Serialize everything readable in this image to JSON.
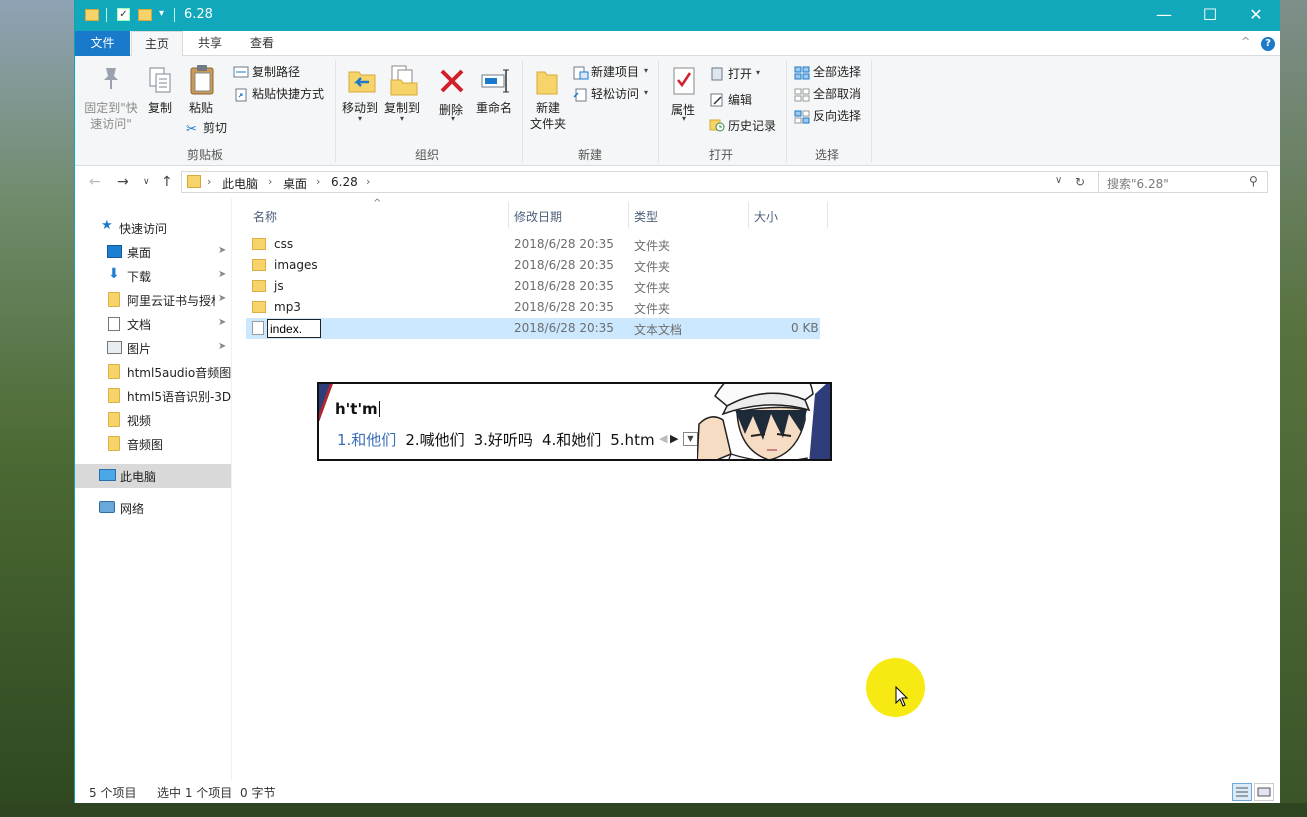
{
  "window": {
    "title": "6.28",
    "quick_access_toolbar": [
      "folder-icon",
      "properties-check-icon",
      "new-folder-icon",
      "customize-arrow"
    ]
  },
  "menu": {
    "file": "文件",
    "tabs": [
      {
        "label": "主页",
        "active": true
      },
      {
        "label": "共享",
        "active": false
      },
      {
        "label": "查看",
        "active": false
      }
    ],
    "help": "?"
  },
  "ribbon": {
    "clipboard": {
      "label": "剪贴板",
      "pin": "固定到\"快速访问\"",
      "copy": "复制",
      "paste": "粘贴",
      "copy_path": "复制路径",
      "paste_shortcut": "粘贴快捷方式",
      "cut": "剪切"
    },
    "organize": {
      "label": "组织",
      "move_to": "移动到",
      "copy_to": "复制到",
      "delete": "删除",
      "rename": "重命名"
    },
    "new": {
      "label": "新建",
      "new_folder": "新建\n文件夹",
      "new_item": "新建项目",
      "easy_access": "轻松访问"
    },
    "open": {
      "label": "打开",
      "properties": "属性",
      "open": "打开",
      "edit": "编辑",
      "history": "历史记录"
    },
    "select": {
      "label": "选择",
      "select_all": "全部选择",
      "select_none": "全部取消",
      "invert": "反向选择"
    }
  },
  "address": {
    "crumbs": [
      "此电脑",
      "桌面",
      "6.28"
    ],
    "search_placeholder": "搜索\"6.28\""
  },
  "nav": {
    "quick_access": "快速访问",
    "items": [
      {
        "label": "桌面",
        "icon": "desktop-icon",
        "pinned": true
      },
      {
        "label": "下载",
        "icon": "download-icon",
        "pinned": true
      },
      {
        "label": "阿里云证书与授权",
        "icon": "folder-icon",
        "pinned": true
      },
      {
        "label": "文档",
        "icon": "document-icon",
        "pinned": true
      },
      {
        "label": "图片",
        "icon": "picture-icon",
        "pinned": true
      },
      {
        "label": "html5audio音频图形",
        "icon": "folder-icon",
        "pinned": false
      },
      {
        "label": "html5语音识别-3D效果",
        "icon": "folder-icon",
        "pinned": false
      },
      {
        "label": "视频",
        "icon": "folder-icon",
        "pinned": false
      },
      {
        "label": "音频图",
        "icon": "folder-icon",
        "pinned": false
      }
    ],
    "this_pc": "此电脑",
    "network": "网络"
  },
  "files": {
    "columns": {
      "name": "名称",
      "modified": "修改日期",
      "type": "类型",
      "size": "大小"
    },
    "rows": [
      {
        "name": "css",
        "modified": "2018/6/28 20:35",
        "type": "文件夹",
        "size": "",
        "icon": "folder-icon"
      },
      {
        "name": "images",
        "modified": "2018/6/28 20:35",
        "type": "文件夹",
        "size": "",
        "icon": "folder-icon"
      },
      {
        "name": "js",
        "modified": "2018/6/28 20:35",
        "type": "文件夹",
        "size": "",
        "icon": "folder-icon"
      },
      {
        "name": "mp3",
        "modified": "2018/6/28 20:35",
        "type": "文件夹",
        "size": "",
        "icon": "folder-icon"
      },
      {
        "name": "index.",
        "modified": "2018/6/28 20:35",
        "type": "文本文档",
        "size": "0 KB",
        "icon": "text-file-icon",
        "selected": true,
        "renaming": true
      }
    ]
  },
  "status": {
    "count": "5 个项目",
    "selected": "选中 1 个项目",
    "size": "0 字节"
  },
  "ime": {
    "composition": "h't'm",
    "candidates": [
      "1.和他们",
      "2.喊他们",
      "3.好听吗",
      "4.和她们",
      "5.htm"
    ]
  },
  "colors": {
    "titlebar": "#11a8bb",
    "file_tab": "#1979ca",
    "selection": "#cce8ff",
    "cursor_highlight": "#f6ea12"
  }
}
